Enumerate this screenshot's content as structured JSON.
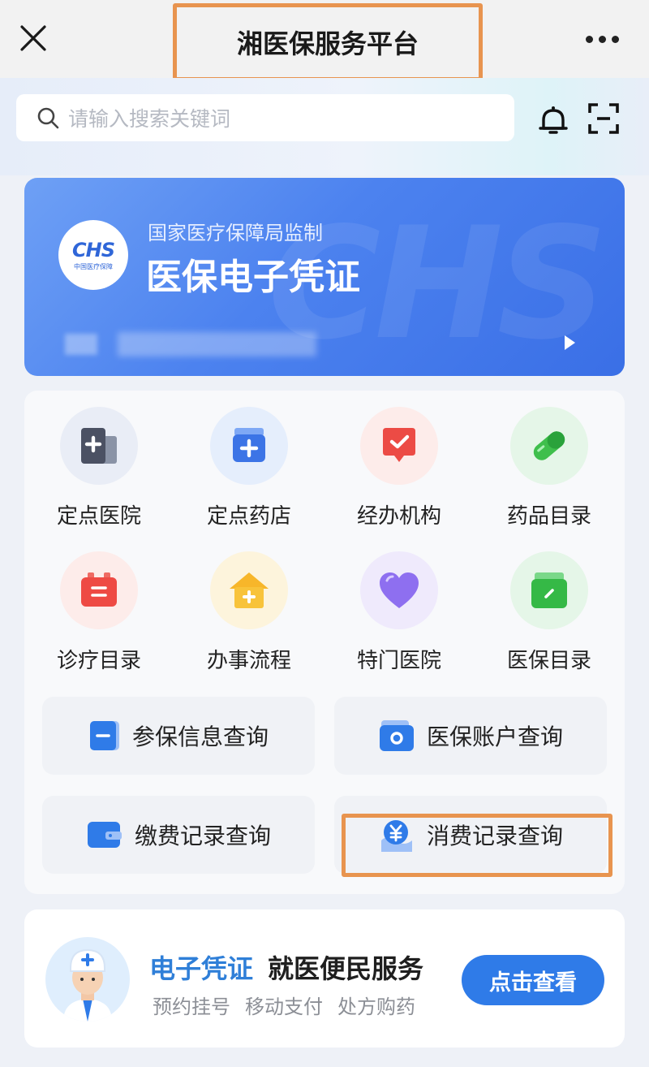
{
  "header": {
    "title": "湘医保服务平台",
    "close_icon": "close-icon",
    "more_icon": "more-icon"
  },
  "search": {
    "placeholder": "请输入搜索关键词",
    "icons": [
      "search-icon",
      "bell-icon",
      "scan-icon"
    ]
  },
  "banner": {
    "logo_text": "CHS",
    "logo_subtext": "中国医疗保障",
    "subtitle": "国家医疗保障局监制",
    "title": "医保电子凭证"
  },
  "services": [
    {
      "label": "定点医院",
      "icon": "hospital-icon"
    },
    {
      "label": "定点药店",
      "icon": "pharmacy-icon"
    },
    {
      "label": "经办机构",
      "icon": "agency-icon"
    },
    {
      "label": "药品目录",
      "icon": "medicine-icon"
    },
    {
      "label": "诊疗目录",
      "icon": "treatment-icon"
    },
    {
      "label": "办事流程",
      "icon": "process-icon"
    },
    {
      "label": "特门医院",
      "icon": "heart-icon"
    },
    {
      "label": "医保目录",
      "icon": "insurance-catalog-icon"
    }
  ],
  "queries": [
    {
      "label": "参保信息查询",
      "icon": "card-icon"
    },
    {
      "label": "医保账户查询",
      "icon": "wallet-icon"
    },
    {
      "label": "缴费记录查询",
      "icon": "payment-icon"
    },
    {
      "label": "消费记录查询",
      "icon": "yuan-icon"
    }
  ],
  "promo": {
    "title_highlight": "电子凭证",
    "title_rest": "就医便民服务",
    "tags": [
      "预约挂号",
      "移动支付",
      "处方购药"
    ],
    "button": "点击查看"
  },
  "colors": {
    "accent": "#2f7be8",
    "highlight_border": "#e8944f",
    "banner_blue": "#4c82ef"
  }
}
